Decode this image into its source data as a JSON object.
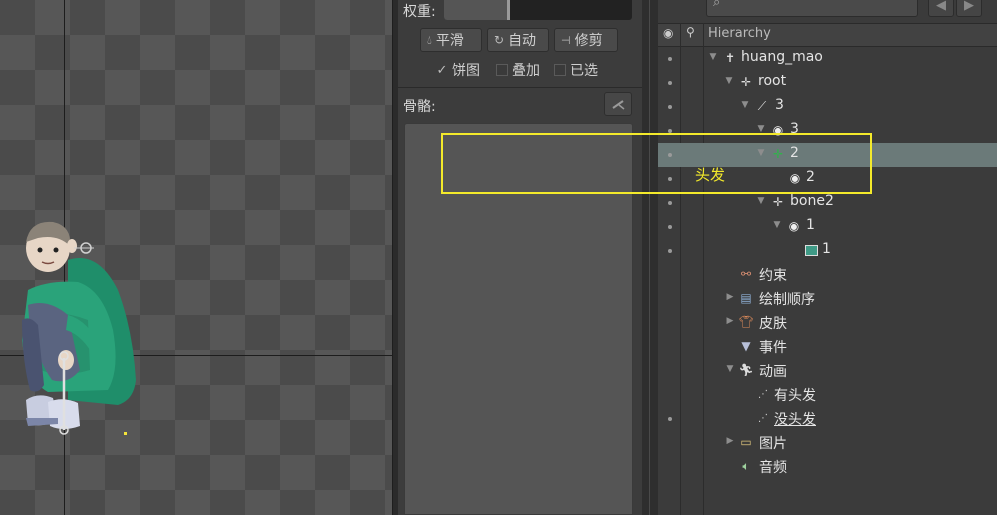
{
  "mid": {
    "weight_label": "权重:",
    "buttons": {
      "smooth": "平滑",
      "auto": "自动",
      "trim": "修剪"
    },
    "checks": {
      "pie": "饼图",
      "overlay": "叠加",
      "selected": "已选"
    },
    "bones_label": "骨骼:"
  },
  "hierarchy": {
    "header_title": "Hierarchy",
    "rows": [
      {
        "label": "huang_mao",
        "icon": "skeleton-icon"
      },
      {
        "label": "root",
        "icon": "bone-cross-icon"
      },
      {
        "label": "3",
        "icon": "bone-icon"
      },
      {
        "label": "3",
        "icon": "slot-icon"
      },
      {
        "label": "2",
        "icon": "bone-cross-green-icon"
      },
      {
        "label": "2",
        "icon": "slot-icon"
      },
      {
        "label": "bone2",
        "icon": "bone-cross-icon"
      },
      {
        "label": "1",
        "icon": "slot-icon"
      },
      {
        "label": "1",
        "icon": "region-icon"
      },
      {
        "label": "约束",
        "icon": "constraint-icon"
      },
      {
        "label": "绘制顺序",
        "icon": "draw-order-icon"
      },
      {
        "label": "皮肤",
        "icon": "skin-icon"
      },
      {
        "label": "事件",
        "icon": "event-icon"
      },
      {
        "label": "动画",
        "icon": "animation-icon"
      },
      {
        "label": "有头发",
        "icon": "anim-clip-icon"
      },
      {
        "label": "没头发",
        "icon": "anim-clip-icon"
      },
      {
        "label": "图片",
        "icon": "images-folder-icon"
      },
      {
        "label": "音频",
        "icon": "audio-icon"
      }
    ]
  },
  "annotation": {
    "text": "头发",
    "color": "#f4ea2b"
  },
  "colors": {
    "selection": "#6b7a79",
    "accent_green": "#2fb34a",
    "annotation": "#f4ea2b"
  }
}
